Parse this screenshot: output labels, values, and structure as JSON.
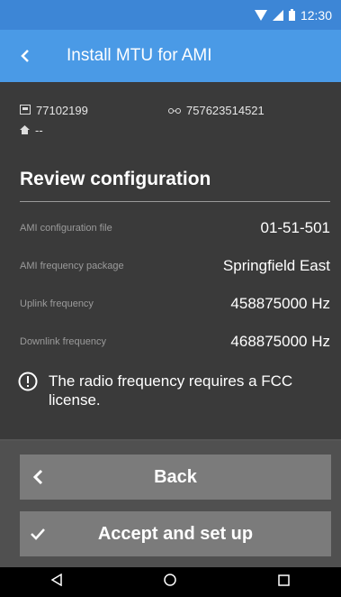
{
  "status_bar": {
    "time": "12:30"
  },
  "app_bar": {
    "title": "Install MTU for AMI"
  },
  "ids": {
    "meter_id": "77102199",
    "mtu_id": "757623514521",
    "address": "--"
  },
  "review": {
    "heading": "Review configuration",
    "fields": [
      {
        "label": "AMI configuration file",
        "value": "01-51-501"
      },
      {
        "label": "AMI frequency package",
        "value": "Springfield East"
      },
      {
        "label": "Uplink frequency",
        "value": "458875000 Hz"
      },
      {
        "label": "Downlink frequency",
        "value": "468875000 Hz"
      }
    ],
    "notice": "The radio frequency requires a FCC license."
  },
  "buttons": {
    "back": "Back",
    "accept": "Accept and set up"
  },
  "colors": {
    "status_bar": "#3d86d6",
    "app_bar": "#4a9ae6",
    "button": "#7b7b7b",
    "background": "#3a3a3a"
  }
}
